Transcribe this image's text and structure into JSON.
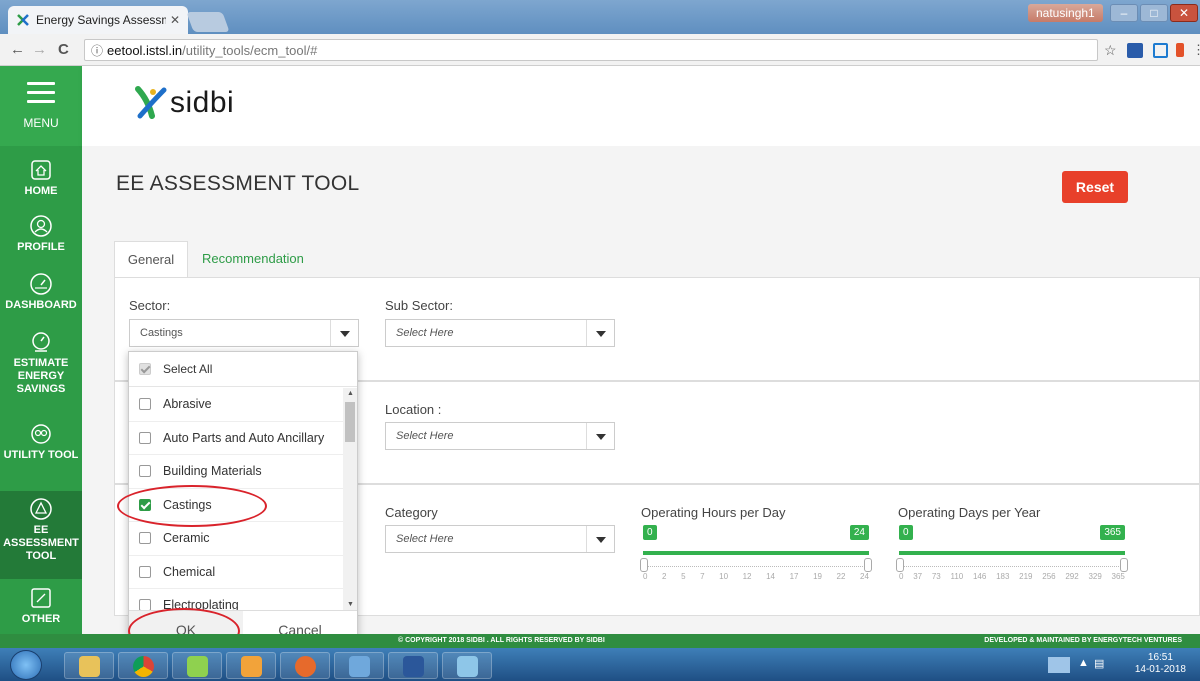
{
  "browser": {
    "tab_title": "Energy Savings Assessme",
    "url_host": "eetool.istsl.in",
    "url_path": "/utility_tools/ecm_tool/#",
    "user": "natusingh1",
    "back": "←",
    "forward": "→",
    "reload": "C",
    "star": "☆"
  },
  "sidebar": {
    "menu_label": "MENU",
    "items": [
      {
        "label": "HOME"
      },
      {
        "label": "PROFILE"
      },
      {
        "label": "DASHBOARD"
      },
      {
        "label": "ESTIMATE ENERGY SAVINGS"
      },
      {
        "label": "UTILITY TOOL"
      },
      {
        "label": "EE ASSESSMENT TOOL"
      },
      {
        "label": "OTHER"
      }
    ]
  },
  "header": {
    "logo_text": "sidbi"
  },
  "page": {
    "title": "EE ASSESSMENT TOOL",
    "reset_label": "Reset",
    "tabs": [
      {
        "label": "General"
      },
      {
        "label": "Recommendation"
      }
    ]
  },
  "form": {
    "sector_label": "Sector:",
    "sector_value": "Castings",
    "subsector_label": "Sub Sector:",
    "subsector_placeholder": "Select Here",
    "location_label": "Location :",
    "location_placeholder": "Select Here",
    "category_label": "Category",
    "category_placeholder": "Select Here",
    "hours_label": "Operating Hours per Day",
    "hours_min": "0",
    "hours_max": "24",
    "hours_ticks": [
      "0",
      "2",
      "5",
      "7",
      "10",
      "12",
      "14",
      "17",
      "19",
      "22",
      "24"
    ],
    "days_label": "Operating Days per Year",
    "days_min": "0",
    "days_max": "365",
    "days_ticks": [
      "0",
      "37",
      "73",
      "110",
      "146",
      "183",
      "219",
      "256",
      "292",
      "329",
      "365"
    ]
  },
  "dropdown": {
    "select_all": "Select All",
    "items": [
      {
        "label": "Abrasive",
        "checked": false
      },
      {
        "label": "Auto Parts and Auto Ancillary",
        "checked": false
      },
      {
        "label": "Building Materials",
        "checked": false
      },
      {
        "label": "Castings",
        "checked": true
      },
      {
        "label": "Ceramic",
        "checked": false
      },
      {
        "label": "Chemical",
        "checked": false
      },
      {
        "label": "Electroplating",
        "checked": false
      }
    ],
    "ok_label": "OK",
    "cancel_label": "Cancel"
  },
  "footer": {
    "copyright": "© COPYRIGHT 2018 SIDBI . ALL RIGHTS RESERVED BY SIDBI",
    "developer": "DEVELOPED & MAINTAINED BY ENERGYTECH VENTURES"
  },
  "taskbar": {
    "time": "16:51",
    "date": "14-01-2018"
  },
  "colors": {
    "sidebar": "#2e9c47",
    "accent_green": "#33b14e",
    "reset_red": "#e8402a",
    "annotation_red": "#d9232b"
  }
}
